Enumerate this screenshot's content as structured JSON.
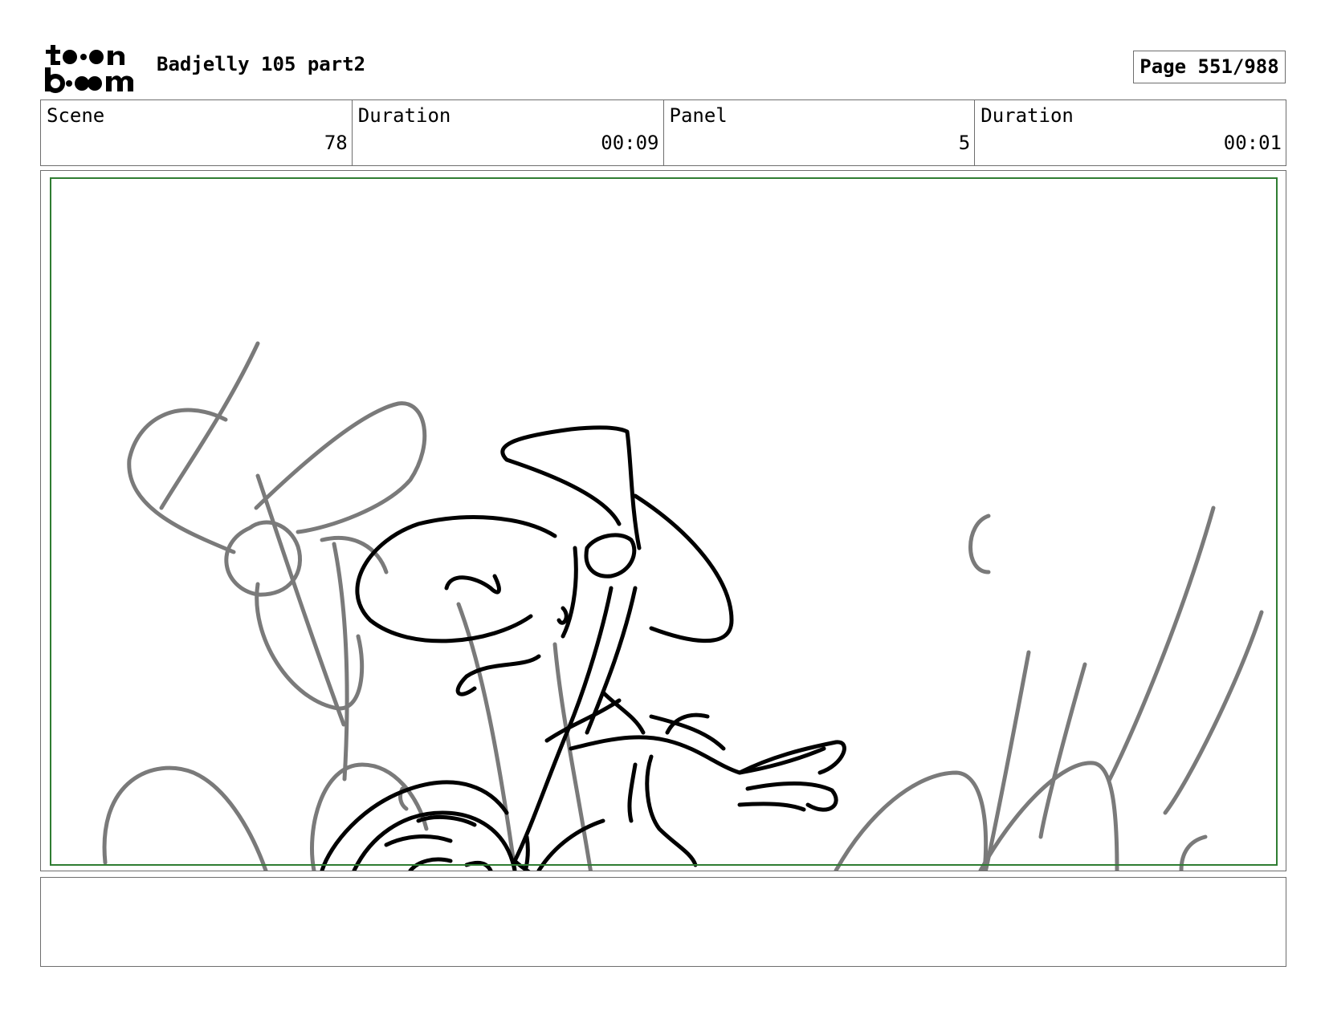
{
  "header": {
    "logo_line1": "toon",
    "logo_line2": "boom",
    "title": "Badjelly 105 part2",
    "page": "Page 551/988"
  },
  "info": {
    "scene_label": "Scene",
    "scene_value": "78",
    "scene_duration_label": "Duration",
    "scene_duration_value": "00:09",
    "panel_label": "Panel",
    "panel_value": "5",
    "panel_duration_label": "Duration",
    "panel_duration_value": "00:01"
  },
  "colors": {
    "frame_border": "#6e6e6e",
    "safe_area": "#2f7d32",
    "sketch_rough": "#7a7a7a",
    "sketch_ink": "#000000"
  },
  "notes": {
    "text": ""
  }
}
